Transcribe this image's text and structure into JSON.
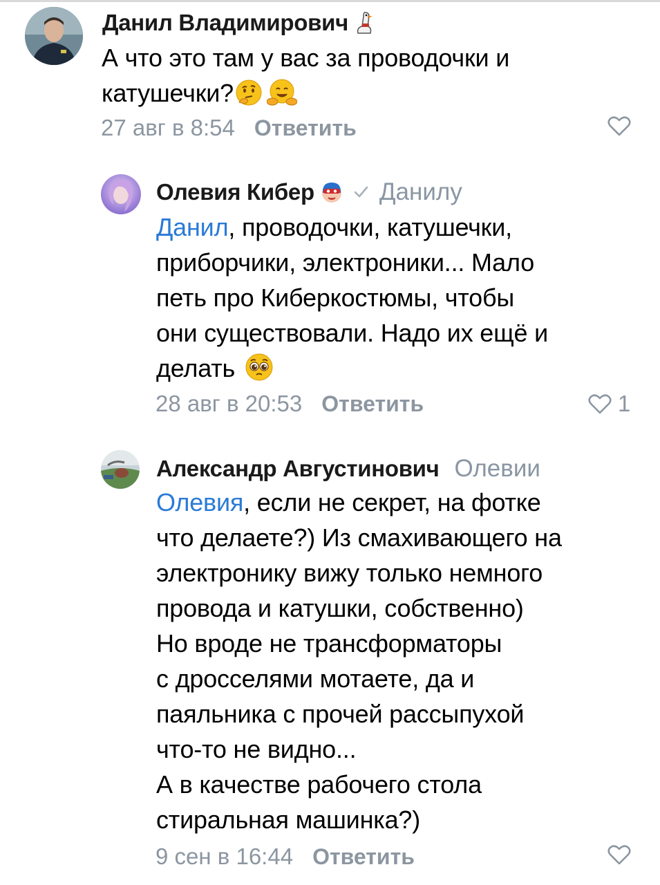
{
  "comments": [
    {
      "author": "Данил Владимирович",
      "author_badge_icon": "goose-icon",
      "lines": [
        "А что это там у вас за проводочки и",
        "катушечки?"
      ],
      "emoji": [
        "thinking-face-emoji",
        "hugging-face-emoji"
      ],
      "date": "27 авг в 8:54",
      "reply_label": "Ответить",
      "like_count": ""
    },
    {
      "author": "Олевия Кибер",
      "author_badge_icon": "mask-emoji-icon",
      "verified_icon": "checkmark-icon",
      "reply_to": "Данилу",
      "mention": "Данил",
      "lines": [
        ", проводочки, катушечки,",
        "приборчики, электроники... Мало",
        "петь про Киберкостюмы, чтобы",
        "они существовали. Надо их ещё и",
        "делать"
      ],
      "emoji": [
        "pleading-face-emoji"
      ],
      "date": "28 авг в 20:53",
      "reply_label": "Ответить",
      "like_count": "1"
    },
    {
      "author": "Александр Августинович",
      "reply_to": "Олевии",
      "mention": "Олевия",
      "lines": [
        ", если не секрет, на фотке",
        "что делаете?) Из смахивающего на",
        "электронику вижу только немного",
        "провода и катушки, собственно)",
        "Но вроде не трансформаторы",
        "с дросселями мотаете, да и",
        "паяльника с прочей рассыпухой",
        "что-то не видно...",
        "А в качестве рабочего стола",
        "стиральная машинка?)"
      ],
      "date": "9 сен в 16:44",
      "reply_label": "Ответить",
      "like_count": ""
    }
  ],
  "colors": {
    "mention": "#2a7ad6",
    "meta": "#8c96a1",
    "reply_to": "#8a96a3"
  }
}
